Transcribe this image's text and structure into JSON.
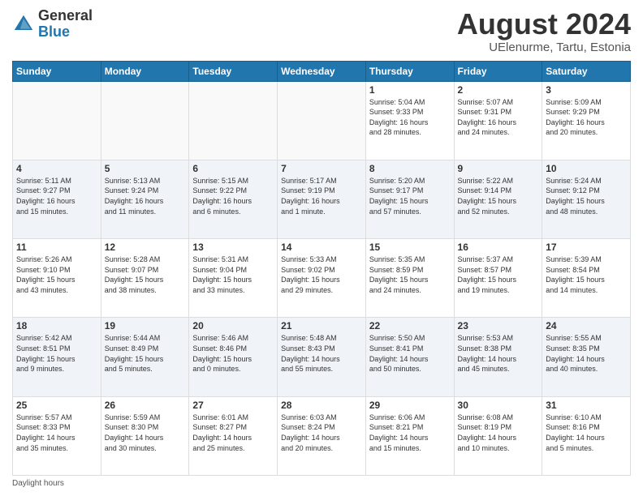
{
  "logo": {
    "line1": "General",
    "line2": "Blue"
  },
  "title": "August 2024",
  "subtitle": "UElenurme, Tartu, Estonia",
  "days_of_week": [
    "Sunday",
    "Monday",
    "Tuesday",
    "Wednesday",
    "Thursday",
    "Friday",
    "Saturday"
  ],
  "footer_label": "Daylight hours",
  "weeks": [
    [
      {
        "day": "",
        "info": ""
      },
      {
        "day": "",
        "info": ""
      },
      {
        "day": "",
        "info": ""
      },
      {
        "day": "",
        "info": ""
      },
      {
        "day": "1",
        "info": "Sunrise: 5:04 AM\nSunset: 9:33 PM\nDaylight: 16 hours\nand 28 minutes."
      },
      {
        "day": "2",
        "info": "Sunrise: 5:07 AM\nSunset: 9:31 PM\nDaylight: 16 hours\nand 24 minutes."
      },
      {
        "day": "3",
        "info": "Sunrise: 5:09 AM\nSunset: 9:29 PM\nDaylight: 16 hours\nand 20 minutes."
      }
    ],
    [
      {
        "day": "4",
        "info": "Sunrise: 5:11 AM\nSunset: 9:27 PM\nDaylight: 16 hours\nand 15 minutes."
      },
      {
        "day": "5",
        "info": "Sunrise: 5:13 AM\nSunset: 9:24 PM\nDaylight: 16 hours\nand 11 minutes."
      },
      {
        "day": "6",
        "info": "Sunrise: 5:15 AM\nSunset: 9:22 PM\nDaylight: 16 hours\nand 6 minutes."
      },
      {
        "day": "7",
        "info": "Sunrise: 5:17 AM\nSunset: 9:19 PM\nDaylight: 16 hours\nand 1 minute."
      },
      {
        "day": "8",
        "info": "Sunrise: 5:20 AM\nSunset: 9:17 PM\nDaylight: 15 hours\nand 57 minutes."
      },
      {
        "day": "9",
        "info": "Sunrise: 5:22 AM\nSunset: 9:14 PM\nDaylight: 15 hours\nand 52 minutes."
      },
      {
        "day": "10",
        "info": "Sunrise: 5:24 AM\nSunset: 9:12 PM\nDaylight: 15 hours\nand 48 minutes."
      }
    ],
    [
      {
        "day": "11",
        "info": "Sunrise: 5:26 AM\nSunset: 9:10 PM\nDaylight: 15 hours\nand 43 minutes."
      },
      {
        "day": "12",
        "info": "Sunrise: 5:28 AM\nSunset: 9:07 PM\nDaylight: 15 hours\nand 38 minutes."
      },
      {
        "day": "13",
        "info": "Sunrise: 5:31 AM\nSunset: 9:04 PM\nDaylight: 15 hours\nand 33 minutes."
      },
      {
        "day": "14",
        "info": "Sunrise: 5:33 AM\nSunset: 9:02 PM\nDaylight: 15 hours\nand 29 minutes."
      },
      {
        "day": "15",
        "info": "Sunrise: 5:35 AM\nSunset: 8:59 PM\nDaylight: 15 hours\nand 24 minutes."
      },
      {
        "day": "16",
        "info": "Sunrise: 5:37 AM\nSunset: 8:57 PM\nDaylight: 15 hours\nand 19 minutes."
      },
      {
        "day": "17",
        "info": "Sunrise: 5:39 AM\nSunset: 8:54 PM\nDaylight: 15 hours\nand 14 minutes."
      }
    ],
    [
      {
        "day": "18",
        "info": "Sunrise: 5:42 AM\nSunset: 8:51 PM\nDaylight: 15 hours\nand 9 minutes."
      },
      {
        "day": "19",
        "info": "Sunrise: 5:44 AM\nSunset: 8:49 PM\nDaylight: 15 hours\nand 5 minutes."
      },
      {
        "day": "20",
        "info": "Sunrise: 5:46 AM\nSunset: 8:46 PM\nDaylight: 15 hours\nand 0 minutes."
      },
      {
        "day": "21",
        "info": "Sunrise: 5:48 AM\nSunset: 8:43 PM\nDaylight: 14 hours\nand 55 minutes."
      },
      {
        "day": "22",
        "info": "Sunrise: 5:50 AM\nSunset: 8:41 PM\nDaylight: 14 hours\nand 50 minutes."
      },
      {
        "day": "23",
        "info": "Sunrise: 5:53 AM\nSunset: 8:38 PM\nDaylight: 14 hours\nand 45 minutes."
      },
      {
        "day": "24",
        "info": "Sunrise: 5:55 AM\nSunset: 8:35 PM\nDaylight: 14 hours\nand 40 minutes."
      }
    ],
    [
      {
        "day": "25",
        "info": "Sunrise: 5:57 AM\nSunset: 8:33 PM\nDaylight: 14 hours\nand 35 minutes."
      },
      {
        "day": "26",
        "info": "Sunrise: 5:59 AM\nSunset: 8:30 PM\nDaylight: 14 hours\nand 30 minutes."
      },
      {
        "day": "27",
        "info": "Sunrise: 6:01 AM\nSunset: 8:27 PM\nDaylight: 14 hours\nand 25 minutes."
      },
      {
        "day": "28",
        "info": "Sunrise: 6:03 AM\nSunset: 8:24 PM\nDaylight: 14 hours\nand 20 minutes."
      },
      {
        "day": "29",
        "info": "Sunrise: 6:06 AM\nSunset: 8:21 PM\nDaylight: 14 hours\nand 15 minutes."
      },
      {
        "day": "30",
        "info": "Sunrise: 6:08 AM\nSunset: 8:19 PM\nDaylight: 14 hours\nand 10 minutes."
      },
      {
        "day": "31",
        "info": "Sunrise: 6:10 AM\nSunset: 8:16 PM\nDaylight: 14 hours\nand 5 minutes."
      }
    ]
  ]
}
